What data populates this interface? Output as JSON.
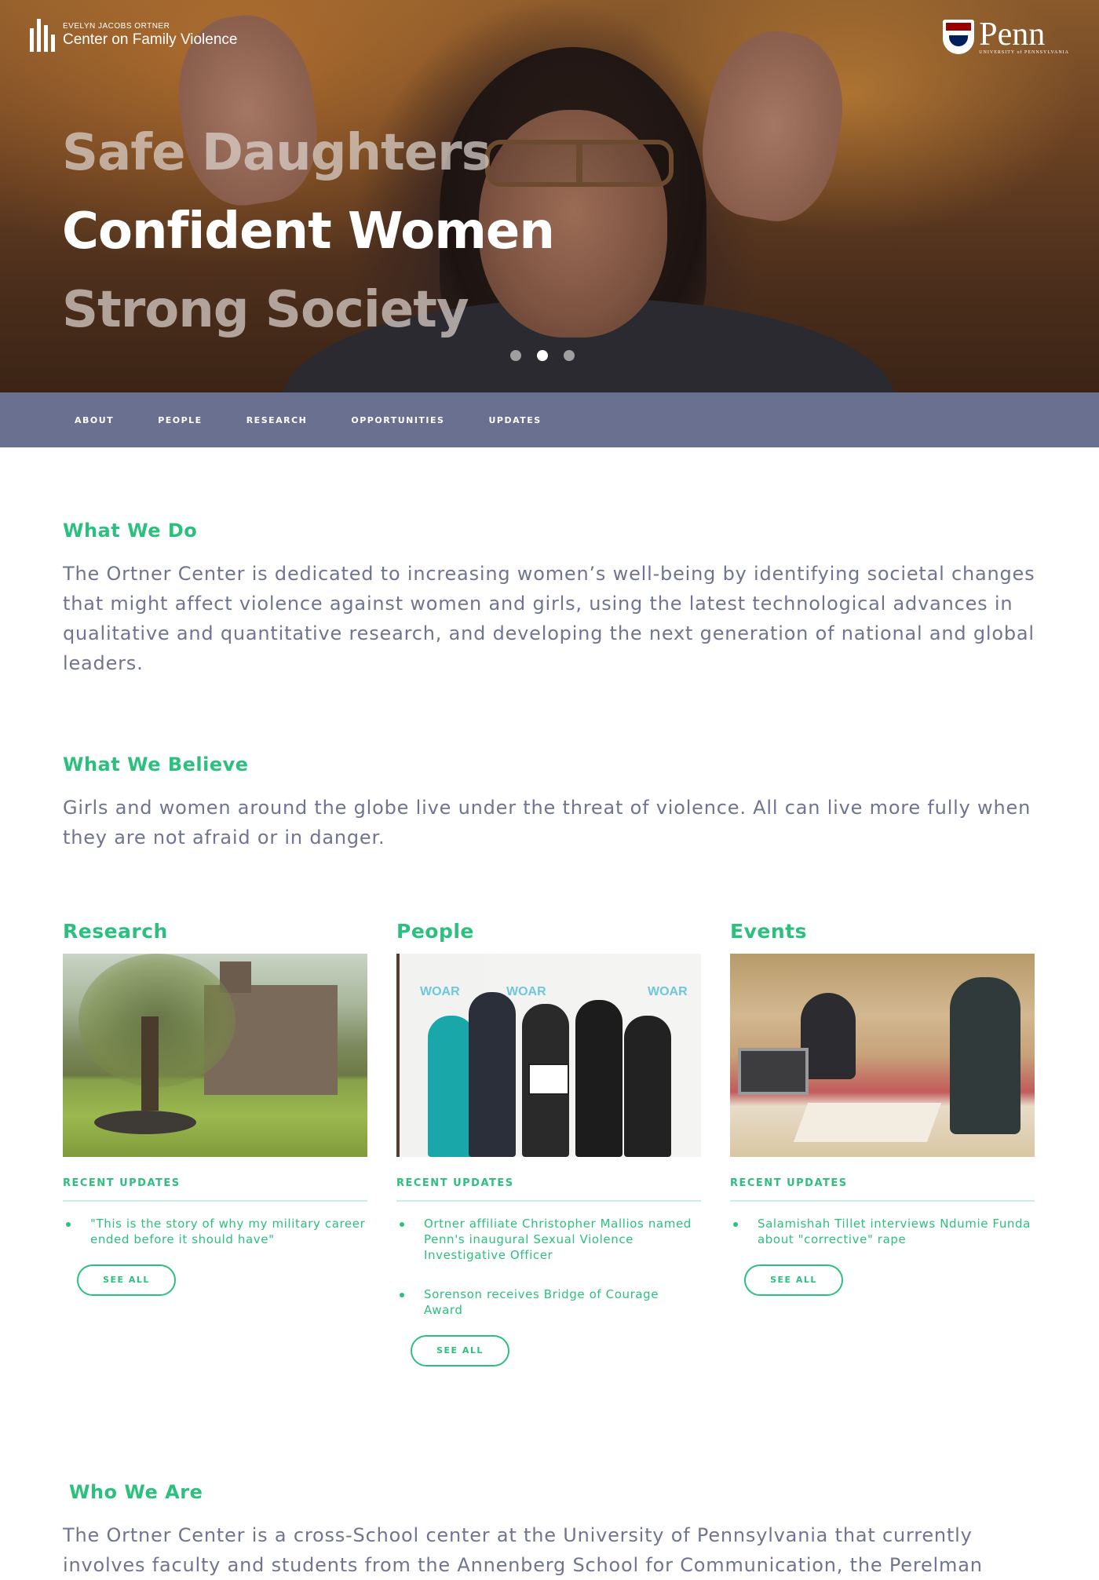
{
  "brand": {
    "line1": "EVELYN JACOBS ORTNER",
    "line2": "Center on Family Violence"
  },
  "penn": {
    "word": "Penn",
    "sub": "UNIVERSITY of PENNSYLVANIA"
  },
  "hero": {
    "lines": [
      "Safe Daughters",
      "Confident Women",
      "Strong Society"
    ],
    "active_slide": 2,
    "slide_count": 3
  },
  "nav": {
    "items": [
      "ABOUT",
      "PEOPLE",
      "RESEARCH",
      "OPPORTUNITIES",
      "UPDATES"
    ]
  },
  "what_we_do": {
    "title": "What We Do",
    "body": "The Ortner Center is dedicated to increasing women’s well-being by identifying societal changes that might affect violence against women and girls, using the latest technological advances in qualitative and quantitative research, and developing the next generation of national and global leaders."
  },
  "what_we_believe": {
    "title": "What We Believe",
    "body": "Girls and women around the globe live under the threat of violence. All can live more fully when they are not afraid or in danger."
  },
  "columns": [
    {
      "title": "Research",
      "updates_label": "RECENT UPDATES",
      "updates": [
        "\"This is the story of why my military career ended before it should have\""
      ],
      "button": "SEE ALL"
    },
    {
      "title": "People",
      "updates_label": "RECENT UPDATES",
      "updates": [
        "Ortner affiliate Christopher Mallios named Penn's inaugural Sexual Violence Investigative Officer",
        "Sorenson receives Bridge of Courage Award"
      ],
      "button": "SEE ALL",
      "photo_logo": "WOAR"
    },
    {
      "title": "Events",
      "updates_label": "RECENT UPDATES",
      "updates": [
        "Salamishah Tillet interviews Ndumie Funda about \"corrective\" rape"
      ],
      "button": "SEE ALL"
    }
  ],
  "who_we_are": {
    "title": "Who We Are",
    "body": "The Ortner Center is a cross-School center at the University of Pennsylvania that currently involves faculty and students from the Annenberg School for Communication, the Perelman"
  }
}
